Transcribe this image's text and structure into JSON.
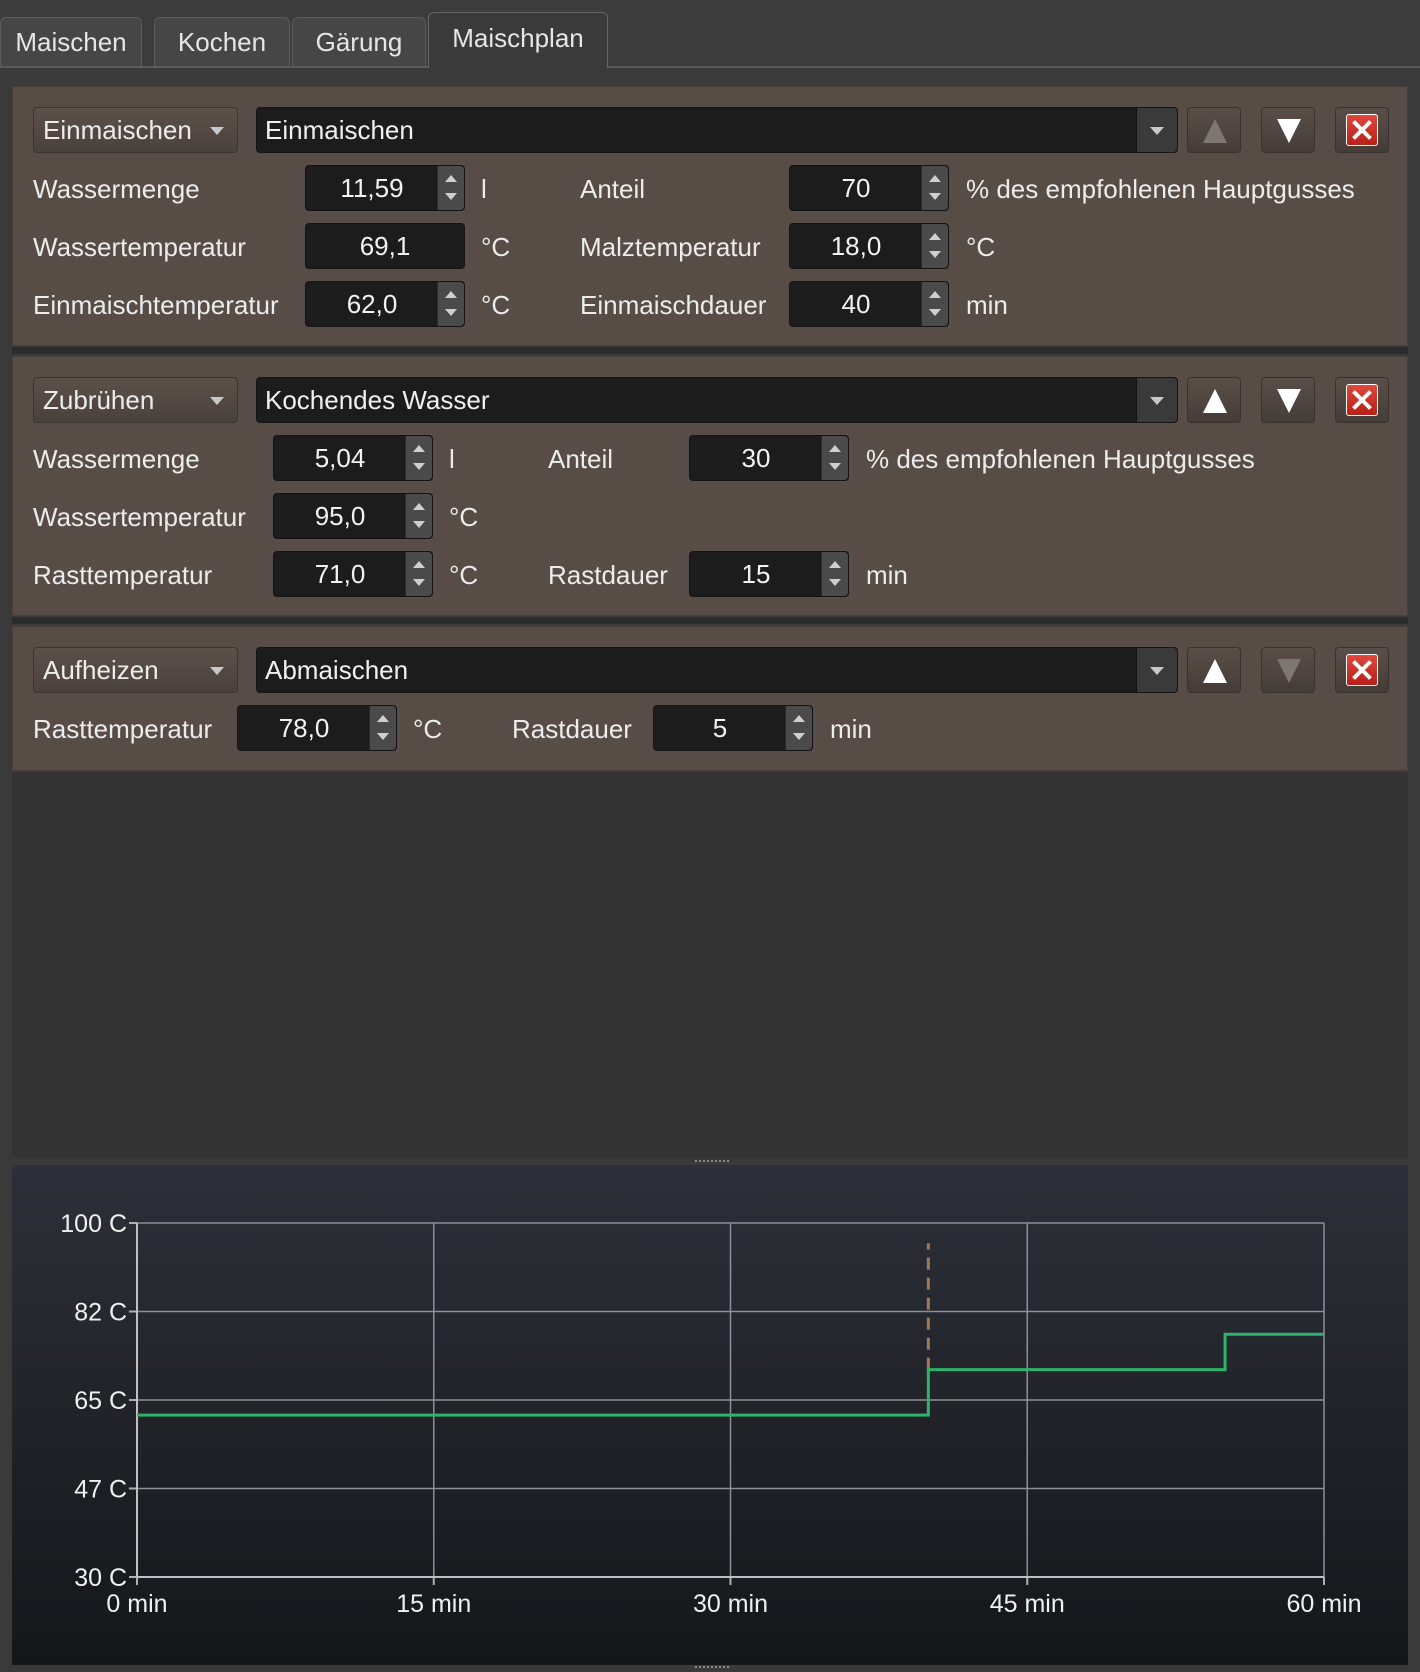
{
  "tabs": [
    {
      "label": "Maischen"
    },
    {
      "label": "Kochen"
    },
    {
      "label": "Gärung"
    },
    {
      "label": "Maischplan",
      "active": true
    }
  ],
  "steps": [
    {
      "type": "Einmaischen",
      "name": "Einmaischen",
      "move_up_enabled": false,
      "move_down_enabled": true,
      "rows": [
        {
          "label": "Wassermenge",
          "value": "11,59",
          "unit": "l",
          "label2": "Anteil",
          "value2": "70",
          "unit2": "% des empfohlenen Hauptgusses"
        },
        {
          "label": "Wassertemperatur",
          "value": "69,1",
          "unit": "°C",
          "label2": "Malztemperatur",
          "value2": "18,0",
          "unit2": "°C"
        },
        {
          "label": "Einmaischtemperatur",
          "value": "62,0",
          "unit": "°C",
          "label2": "Einmaischdauer",
          "value2": "40",
          "unit2": "min"
        }
      ]
    },
    {
      "type": "Zubrühen",
      "name": "Kochendes Wasser",
      "move_up_enabled": true,
      "move_down_enabled": true,
      "rows": [
        {
          "label": "Wassermenge",
          "value": "5,04",
          "unit": "l",
          "label2": "Anteil",
          "value2": "30",
          "unit2": "% des empfohlenen Hauptgusses"
        },
        {
          "label": "Wassertemperatur",
          "value": "95,0",
          "unit": "°C"
        },
        {
          "label": "Rasttemperatur",
          "value": "71,0",
          "unit": "°C",
          "label2": "Rastdauer",
          "value2": "15",
          "unit2": "min"
        }
      ]
    },
    {
      "type": "Aufheizen",
      "name": "Abmaischen",
      "move_up_enabled": true,
      "move_down_enabled": false,
      "rows": [
        {
          "label": "Rasttemperatur",
          "value": "78,0",
          "unit": "°C",
          "label2": "Rastdauer",
          "value2": "5",
          "unit2": "min"
        }
      ]
    }
  ],
  "chart_data": {
    "type": "line",
    "y_ticks": [
      "30 C",
      "47 C",
      "65 C",
      "82 C",
      "100 C"
    ],
    "x_ticks": [
      "0 min",
      "15 min",
      "30 min",
      "45 min",
      "60 min"
    ],
    "xlim": [
      0,
      60
    ],
    "ylim": [
      30,
      100
    ],
    "grid": true,
    "series": [
      {
        "color": "#2fb36b",
        "x": [
          0,
          40,
          40,
          55,
          55,
          60
        ],
        "y": [
          62,
          62,
          71,
          71,
          78,
          78
        ]
      }
    ],
    "markers": [
      {
        "x": 40,
        "y_from": 71,
        "y_to": 96,
        "style": "dashed",
        "color": "#a0785a"
      }
    ]
  }
}
